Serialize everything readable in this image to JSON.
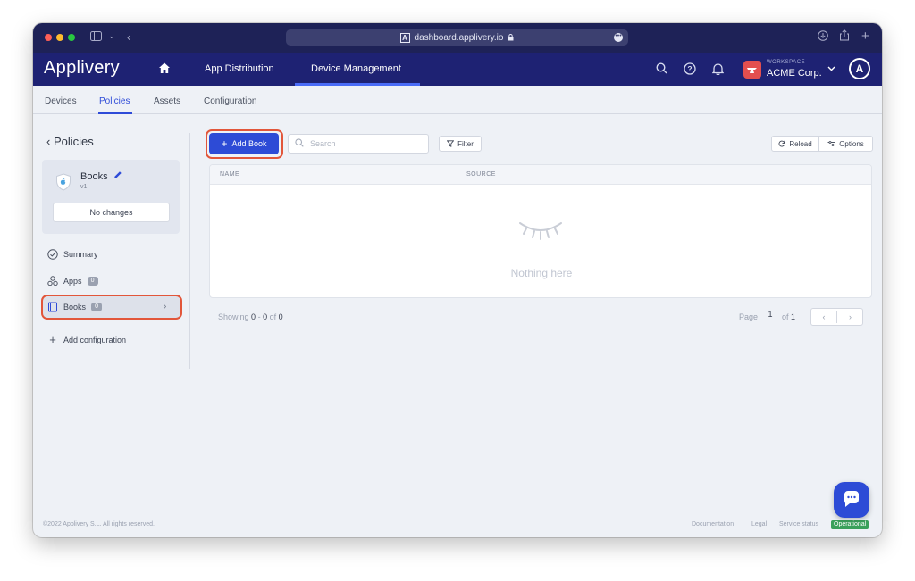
{
  "browser": {
    "url": "dashboard.applivery.io"
  },
  "header": {
    "brand": "Applivery",
    "tabs": [
      "App Distribution",
      "Device Management"
    ],
    "workspace_label": "WORKSPACE",
    "workspace_name": "ACME Corp.",
    "user_initial": "A"
  },
  "subtabs": [
    "Devices",
    "Policies",
    "Assets",
    "Configuration"
  ],
  "sidebar": {
    "back_label": "Policies",
    "policy": {
      "name": "Books",
      "version": "v1",
      "status": "No changes"
    },
    "items": [
      {
        "label": "Summary",
        "icon": "check-circle-icon"
      },
      {
        "label": "Apps",
        "count": "0",
        "icon": "apps-icon"
      },
      {
        "label": "Books",
        "count": "0",
        "icon": "book-icon"
      }
    ],
    "add_label": "Add configuration"
  },
  "toolbar": {
    "add_label": "Add Book",
    "search_placeholder": "Search",
    "filter_label": "Filter",
    "reload_label": "Reload",
    "options_label": "Options"
  },
  "table": {
    "columns": [
      "NAME",
      "SOURCE"
    ],
    "empty_text": "Nothing here"
  },
  "pagination": {
    "showing_prefix": "Showing",
    "from": "0",
    "to": "0",
    "total": "0",
    "page_label": "Page",
    "page": "1",
    "of_label": "of",
    "page_count": "1"
  },
  "footer": {
    "copyright": "©2022 Applivery S.L. All rights reserved.",
    "links": [
      "Documentation",
      "Legal",
      "Service status"
    ],
    "status": "Operational"
  },
  "colors": {
    "primary": "#2d4bd6",
    "nav_bg": "#1e2273",
    "highlight_ring": "#e2563a",
    "status_ok": "#3aa05b"
  }
}
